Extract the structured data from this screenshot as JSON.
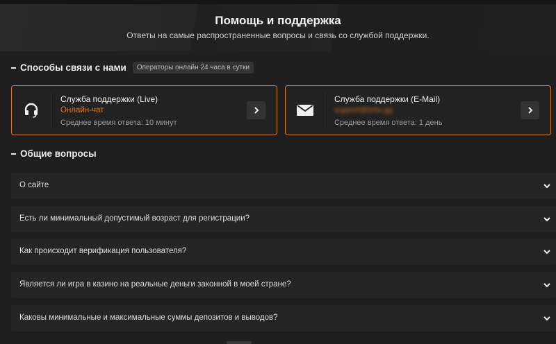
{
  "hero": {
    "title": "Помощь и поддержка",
    "subtitle": "Ответы на самые распространенные вопросы и связь со службой поддержки."
  },
  "contact": {
    "section_title": "Способы связи с нами",
    "badge": "Операторы онлайн 24 часа в сутки",
    "cards": [
      {
        "title": "Служба поддержки (Live)",
        "accent": "Онлайн-чат",
        "meta": "Среднее время ответа: 10 минут",
        "icon": "headset-icon"
      },
      {
        "title": "Служба поддержки (E-Mail)",
        "accent": "support@brlix.gg",
        "meta": "Среднее время ответа: 1 день",
        "icon": "envelope-icon"
      }
    ]
  },
  "faq": {
    "section_title": "Общие вопросы",
    "items": [
      "О сайте",
      "Есть ли минимальный допустимый возраст для регистрации?",
      "Как происходит верификация пользователя?",
      "Является ли игра в казино на реальные деньги законной в моей стране?",
      "Каковы минимальные и максимальные суммы депозитов и выводов?"
    ]
  },
  "colors": {
    "accent": "#e07a1f",
    "background": "#1f1f1f",
    "card": "#252525"
  }
}
